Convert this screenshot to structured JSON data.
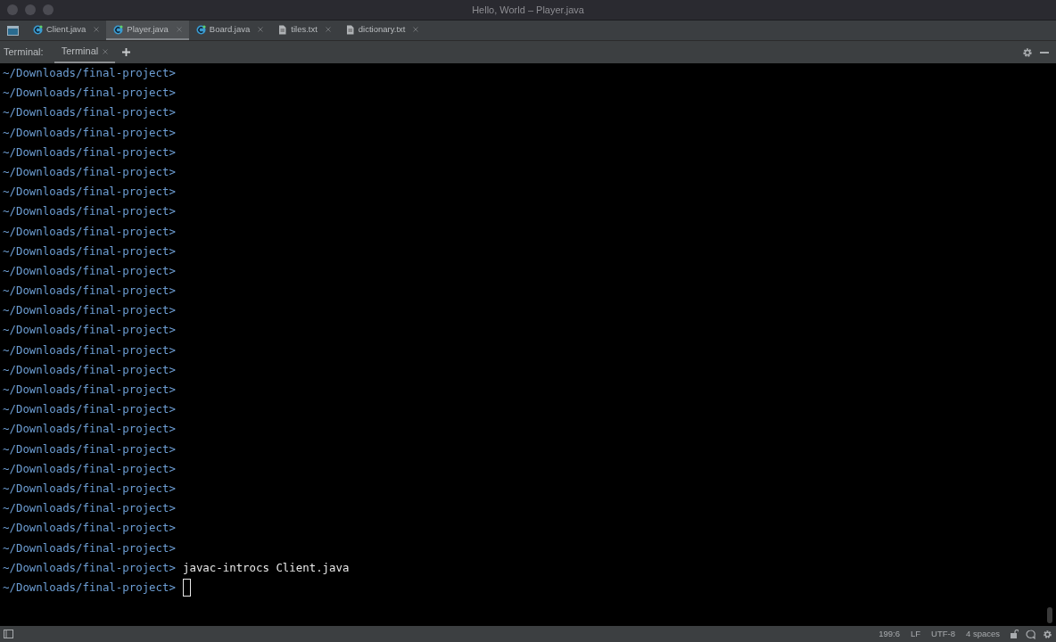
{
  "window": {
    "title": "Hello, World – Player.java"
  },
  "editor_tabs": [
    {
      "label": "Client.java",
      "kind": "java",
      "selected": false
    },
    {
      "label": "Player.java",
      "kind": "java",
      "selected": true
    },
    {
      "label": "Board.java",
      "kind": "java",
      "selected": false
    },
    {
      "label": "tiles.txt",
      "kind": "text",
      "selected": false
    },
    {
      "label": "dictionary.txt",
      "kind": "text",
      "selected": false
    }
  ],
  "terminal_toolbar": {
    "label": "Terminal:",
    "tabs": [
      {
        "label": "Terminal",
        "selected": true
      }
    ]
  },
  "terminal_lines": [
    {
      "prompt": "~/Downloads/final-project>"
    },
    {
      "prompt": "~/Downloads/final-project>"
    },
    {
      "prompt": "~/Downloads/final-project>"
    },
    {
      "prompt": "~/Downloads/final-project>"
    },
    {
      "prompt": "~/Downloads/final-project>"
    },
    {
      "prompt": "~/Downloads/final-project>"
    },
    {
      "prompt": "~/Downloads/final-project>"
    },
    {
      "prompt": "~/Downloads/final-project>"
    },
    {
      "prompt": "~/Downloads/final-project>"
    },
    {
      "prompt": "~/Downloads/final-project>"
    },
    {
      "prompt": "~/Downloads/final-project>"
    },
    {
      "prompt": "~/Downloads/final-project>"
    },
    {
      "prompt": "~/Downloads/final-project>"
    },
    {
      "prompt": "~/Downloads/final-project>"
    },
    {
      "prompt": "~/Downloads/final-project>"
    },
    {
      "prompt": "~/Downloads/final-project>"
    },
    {
      "prompt": "~/Downloads/final-project>"
    },
    {
      "prompt": "~/Downloads/final-project>"
    },
    {
      "prompt": "~/Downloads/final-project>"
    },
    {
      "prompt": "~/Downloads/final-project>"
    },
    {
      "prompt": "~/Downloads/final-project>"
    },
    {
      "prompt": "~/Downloads/final-project>"
    },
    {
      "prompt": "~/Downloads/final-project>"
    },
    {
      "prompt": "~/Downloads/final-project>"
    },
    {
      "prompt": "~/Downloads/final-project>"
    },
    {
      "prompt": "~/Downloads/final-project>",
      "command": "javac-introcs Client.java"
    },
    {
      "prompt": "~/Downloads/final-project>",
      "cursor": true
    }
  ],
  "status_bar": {
    "items": [
      "199:6",
      "LF",
      "UTF-8",
      "4 spaces"
    ]
  }
}
